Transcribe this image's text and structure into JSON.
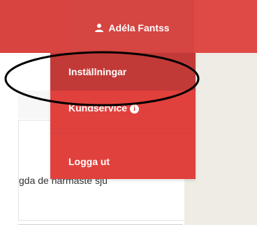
{
  "header": {
    "user_name": "Adéla Fantss",
    "user_icon": "user-icon"
  },
  "dropdown": {
    "items": [
      {
        "label": "Inställningar"
      },
      {
        "label": "Kundservice",
        "icon": "info-icon"
      },
      {
        "label": "Logga ut"
      }
    ]
  },
  "main": {
    "body_text": "gda de närmaste sju"
  },
  "colors": {
    "brand_red": "#e04a46",
    "dropdown_red": "#e1413d",
    "active_item": "#c13a37",
    "sidebar_beige": "#efece5"
  }
}
